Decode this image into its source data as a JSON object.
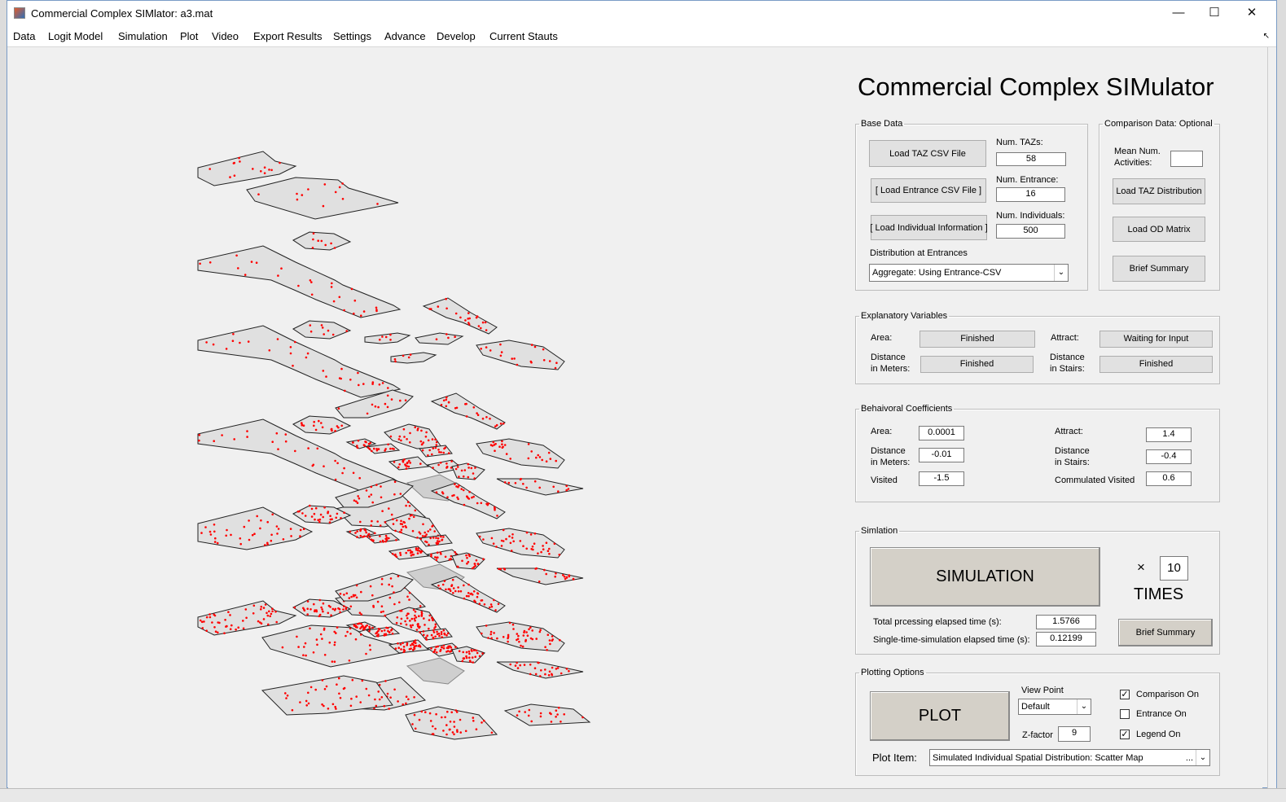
{
  "window": {
    "title": "Commercial Complex SIMlator: a3.mat",
    "minimize": "—",
    "maximize": "☐",
    "close": "✕",
    "dock": "↖"
  },
  "menu": [
    "Data",
    "Logit Model",
    "Simulation",
    "Plot",
    "Video",
    "Export Results",
    "Settings",
    "Advance",
    "Develop",
    "Current Stauts"
  ],
  "app_title": "Commercial Complex SIMulator",
  "base_data": {
    "legend": "Base Data",
    "load_taz": "Load TAZ CSV File",
    "load_entrance": "[ Load Entrance CSV File ]",
    "load_individual": "[ Load Individual Information ]",
    "num_tazs_label": "Num. TAZs:",
    "num_tazs": "58",
    "num_entrance_label": "Num. Entrance:",
    "num_entrance": "16",
    "num_individuals_label": "Num. Individuals:",
    "num_individuals": "500",
    "distribution_label": "Distribution at Entrances",
    "distribution_value": "Aggregate: Using Entrance-CSV"
  },
  "comparison": {
    "legend": "Comparison Data: Optional",
    "mean_label_1": "Mean Num.",
    "mean_label_2": "Activities:",
    "mean_value": "",
    "load_taz_dist": "Load TAZ Distribution",
    "load_od": "Load OD Matrix",
    "brief_summary": "Brief Summary"
  },
  "explanatory": {
    "legend": "Explanatory Variables",
    "area_label": "Area:",
    "area_status": "Finished",
    "attract_label": "Attract:",
    "attract_status": "Waiting for Input",
    "dist_m_label_1": "Distance",
    "dist_m_label_2": "in Meters:",
    "dist_m_status": "Finished",
    "dist_s_label_1": "Distance",
    "dist_s_label_2": "in Stairs:",
    "dist_s_status": "Finished"
  },
  "coefficients": {
    "legend": "Behaivoral Coefficients",
    "area_label": "Area:",
    "area": "0.0001",
    "dist_m_label_1": "Distance",
    "dist_m_label_2": "in Meters:",
    "dist_m": "-0.01",
    "visited_label": "Visited",
    "visited": "-1.5",
    "attract_label": "Attract:",
    "attract": "1.4",
    "dist_s_label_1": "Distance",
    "dist_s_label_2": "in Stairs:",
    "dist_s": "-0.4",
    "cum_label": "Commulated Visited",
    "cum": "0.6"
  },
  "simulation": {
    "legend": "Simlation",
    "button": "SIMULATION",
    "times_x": "×",
    "times_value": "10",
    "times_label": "TIMES",
    "total_label": "Total prcessing elapsed time (s):",
    "total_value": "1.5766",
    "single_label": "Single-time-simulation elapsed time (s):",
    "single_value": "0.12199",
    "brief_summary": "Brief Summary"
  },
  "plotting": {
    "legend": "Plotting Options",
    "plot_button": "PLOT",
    "view_point_label": "View Point",
    "view_point_value": "Default",
    "zfactor_label": "Z-factor",
    "zfactor_value": "9",
    "comparison_on": "Comparison On",
    "comparison_checked": "✓",
    "entrance_on": "Entrance On",
    "legend_on": "Legend On",
    "legend_checked": "✓",
    "plot_item_label": "Plot Item:",
    "plot_item_value": "Simulated Individual Spatial Distribution: Scatter Map",
    "plot_item_ellipsis": "..."
  },
  "map": {
    "fill": "#e0e0e0",
    "stroke": "#222222",
    "point_color": "#ff0000"
  }
}
